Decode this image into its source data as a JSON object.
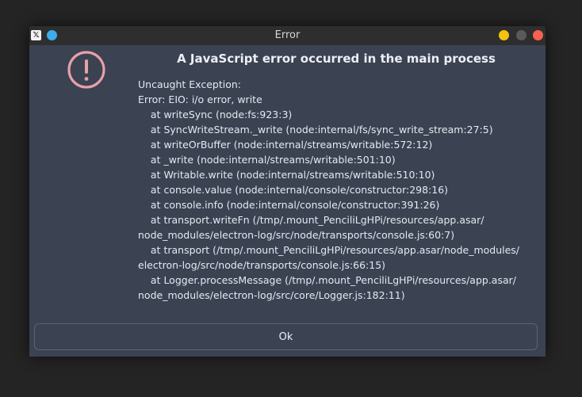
{
  "window": {
    "title": "Error",
    "app_icon_glyph": "𝕏"
  },
  "dialog": {
    "icon": "error-circle-exclamation-icon",
    "heading": "A JavaScript error occurred in the main process",
    "message_lines": [
      "Uncaught Exception:",
      "Error: EIO: i/o error, write",
      "    at writeSync (node:fs:923:3)",
      "    at SyncWriteStream._write (node:internal/fs/sync_write_stream:27:5)",
      "    at writeOrBuffer (node:internal/streams/writable:572:12)",
      "    at _write (node:internal/streams/writable:501:10)",
      "    at Writable.write (node:internal/streams/writable:510:10)",
      "    at console.value (node:internal/console/constructor:298:16)",
      "    at console.info (node:internal/console/constructor:391:26)",
      "    at transport.writeFn (/tmp/.mount_PenciliLgHPi/resources/app.asar/",
      "node_modules/electron-log/src/node/transports/console.js:60:7)",
      "    at transport (/tmp/.mount_PenciliLgHPi/resources/app.asar/node_modules/",
      "electron-log/src/node/transports/console.js:66:15)",
      "    at Logger.processMessage (/tmp/.mount_PenciliLgHPi/resources/app.asar/",
      "node_modules/electron-log/src/core/Logger.js:182:11)"
    ],
    "ok_label": "Ok"
  },
  "colors": {
    "dialog_bg": "#3b4252",
    "titlebar_bg": "#2e2e2e",
    "error_icon": "#e8a0a8",
    "minimize": "#f5c211",
    "maximize": "#5a5a5a",
    "close": "#f66151"
  }
}
